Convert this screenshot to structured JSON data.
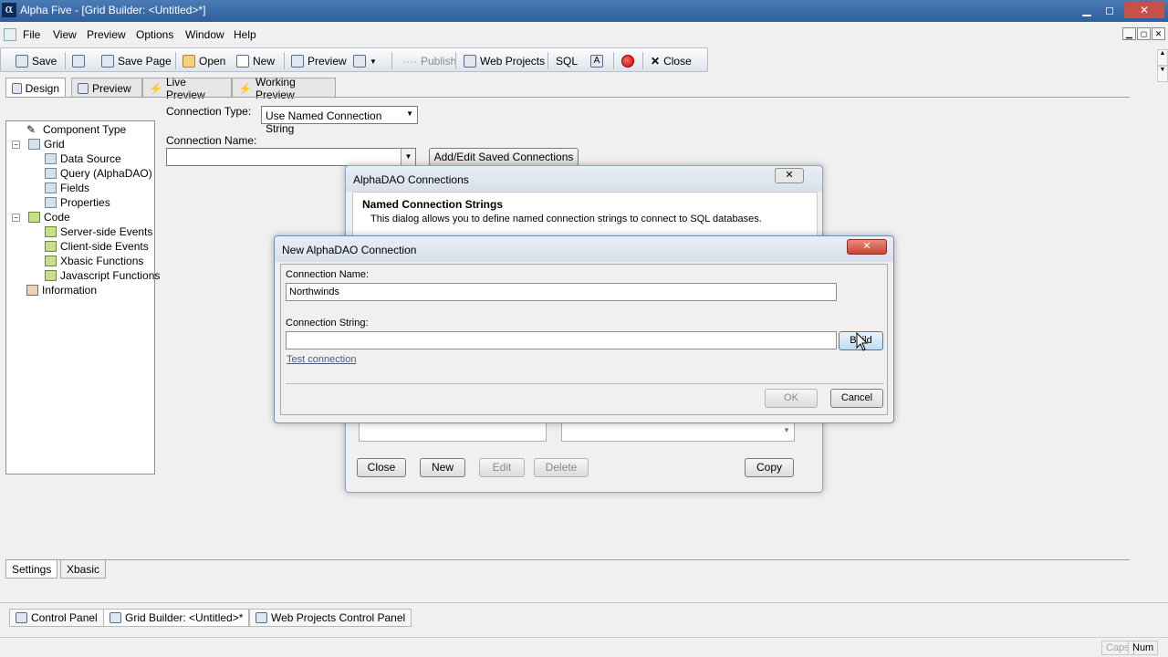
{
  "window": {
    "title": "Alpha Five - [Grid Builder: <Untitled>*]",
    "minimize": "▁",
    "restore": "◻",
    "close": "✕",
    "app_icon": "α"
  },
  "menu": {
    "items": [
      "File",
      "View",
      "Preview",
      "Options",
      "Window",
      "Help"
    ]
  },
  "toolbar": {
    "save": "Save",
    "save_page": "Save Page",
    "open": "Open",
    "new": "New",
    "preview": "Preview",
    "publish": "Publish",
    "web_projects": "Web Projects",
    "sql": "SQL",
    "close": "Close"
  },
  "design_tabs": [
    "Design",
    "Preview",
    "Live Preview",
    "Working Preview"
  ],
  "tree": [
    {
      "label": "Component Type",
      "level": 1,
      "icon": "pencil-icon"
    },
    {
      "label": "Grid",
      "level": 1,
      "icon": "grid-icon",
      "expander": "−"
    },
    {
      "label": "Data Source",
      "level": 2,
      "icon": "grid-icon"
    },
    {
      "label": "Query (AlphaDAO)",
      "level": 2,
      "icon": "grid-icon"
    },
    {
      "label": "Fields",
      "level": 2,
      "icon": "grid-icon"
    },
    {
      "label": "Properties",
      "level": 2,
      "icon": "grid-icon"
    },
    {
      "label": "Code",
      "level": 1,
      "icon": "code-icon",
      "expander": "−"
    },
    {
      "label": "Server-side Events",
      "level": 2,
      "icon": "code-icon"
    },
    {
      "label": "Client-side Events",
      "level": 2,
      "icon": "code-icon"
    },
    {
      "label": "Xbasic Functions",
      "level": 2,
      "icon": "code-icon"
    },
    {
      "label": "Javascript Functions",
      "level": 2,
      "icon": "code-icon"
    },
    {
      "label": "Information",
      "level": 1,
      "icon": "info-icon"
    }
  ],
  "connection": {
    "type_label": "Connection Type:",
    "type_value": "Use Named Connection String",
    "name_label": "Connection Name:",
    "name_value": "",
    "add_edit_button": "Add/Edit Saved Connections"
  },
  "alphadao_dialog": {
    "title": "AlphaDAO Connections",
    "close": "✕",
    "heading": "Named Connection Strings",
    "description": "This dialog allows you to define named connection strings to connect to SQL databases.",
    "buttons": {
      "close": "Close",
      "new": "New",
      "edit": "Edit",
      "delete": "Delete",
      "copy": "Copy"
    }
  },
  "new_connection_dialog": {
    "title": "New AlphaDAO Connection",
    "close": "✕",
    "name_label": "Connection Name:",
    "name_value": "Northwinds",
    "string_label": "Connection String:",
    "string_value": "",
    "build_button": "Build",
    "test_link": "Test connection",
    "ok": "OK",
    "cancel": "Cancel"
  },
  "bottom_tabs": [
    "Settings",
    "Xbasic"
  ],
  "taskbar": [
    "Control Panel",
    "Grid Builder: <Untitled>*",
    "Web Projects Control Panel"
  ],
  "status": {
    "caps": "Caps",
    "num": "Num"
  }
}
